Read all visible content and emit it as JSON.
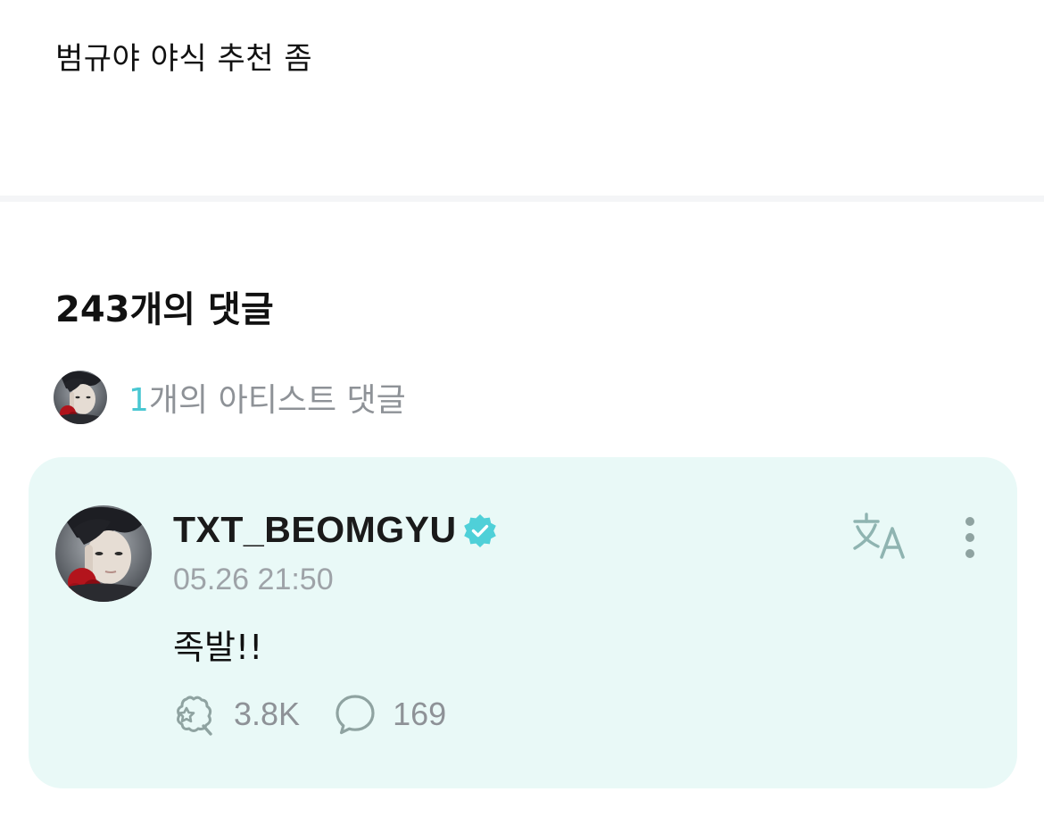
{
  "post": {
    "body": "범규야 야식 추천 좀"
  },
  "comments_header": {
    "title": "243개의 댓글"
  },
  "artist_comments": {
    "count": "1",
    "label": "개의 아티스트 댓글"
  },
  "comment": {
    "author": "TXT_BEOMGYU",
    "verified_icon": "verified-badge-icon",
    "timestamp": "05.26 21:50",
    "text": "족발!!",
    "likes": "3.8K",
    "replies": "169",
    "translate_icon": "translate-icon",
    "more_icon": "more-vertical-icon"
  },
  "colors": {
    "accent": "#49c7d2",
    "card_background": "#e9f9f7",
    "muted_text": "#8e9297",
    "icon_gray": "#8fa3a1"
  }
}
